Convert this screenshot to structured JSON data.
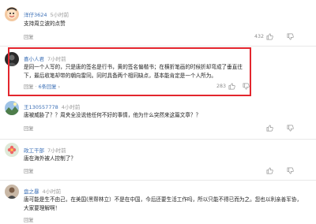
{
  "colors": {
    "link": "#3b6fb6",
    "highlight_border": "#e3262e",
    "meta": "#8b8b8b"
  },
  "comments": [
    {
      "user": "洋仔3624",
      "time": "5小时前",
      "text": "支持周立波的点赞",
      "reply_label": "回复",
      "likes": "432",
      "avatar_icon": "avatar-cartoon"
    },
    {
      "user": "喜小人君",
      "time": "7小时前",
      "text": "是同一个人写的，只是唐的签名是行书，黄的签名偏楷书；在横折笔画的时候折却弯成了垂直往下，最后收笔却带的朝向雷同。同时具备两个相同缺点，基本能肯定是一个人所为。",
      "reply_label": "回复",
      "reply_count": "6条回复",
      "likes": "283",
      "avatar_icon": "avatar-dark-portrait"
    },
    {
      "user": "王130557778",
      "time": "4小时前",
      "text": "唐被威胁了？？周夹全没说他任何不好的事情，他为什么突然来这篇文章？？",
      "reply_label": "回复",
      "likes": "",
      "avatar_icon": "avatar-landscape"
    },
    {
      "user": "政工干部",
      "time": "7小时前",
      "text": "唐在海外被人控制了？",
      "reply_label": "回复",
      "likes": "",
      "avatar_icon": "avatar-flower"
    },
    {
      "user": "盘之暴",
      "time": "4小时前",
      "text": "唐可能是生不由己，在美国(黑帮林立）不是在中国，今后还要生活工作吗，所以只能不得已而为之。您也以利亲善军协，大家要理解啊！",
      "reply_label": "回复",
      "likes": "",
      "avatar_icon": "avatar-person"
    }
  ]
}
